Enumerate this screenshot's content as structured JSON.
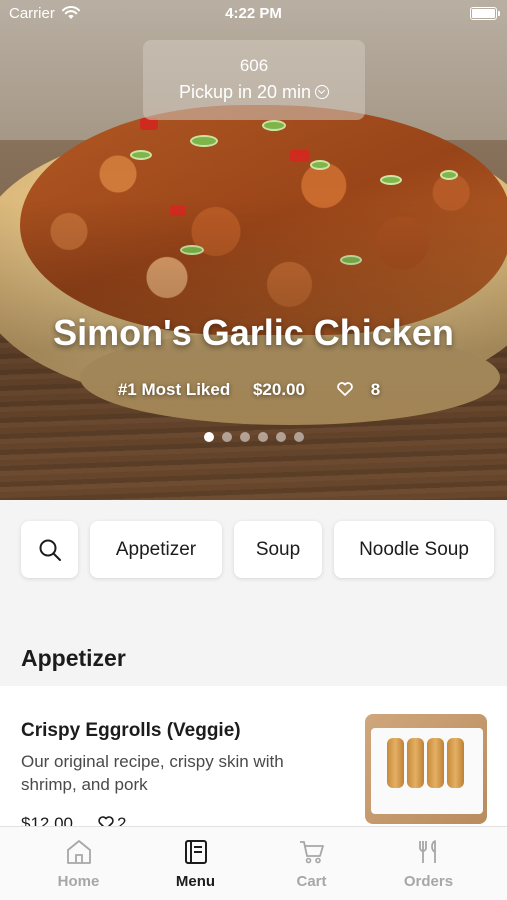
{
  "status_bar": {
    "carrier": "Carrier",
    "time": "4:22 PM"
  },
  "pickup": {
    "store": "606",
    "pickup_text": "Pickup in 20 min"
  },
  "hero": {
    "title": "Simon's Garlic Chicken",
    "badge": "#1 Most Liked",
    "price": "$20.00",
    "likes": "8",
    "carousel": {
      "total": 6,
      "active": 1
    }
  },
  "categories": {
    "search_icon": "search-icon",
    "items": [
      {
        "label": "Appetizer"
      },
      {
        "label": "Soup"
      },
      {
        "label": "Noodle Soup"
      }
    ]
  },
  "section": {
    "title": "Appetizer"
  },
  "menu_items": [
    {
      "name": "Crispy Eggrolls (Veggie)",
      "description": "Our original recipe, crispy skin with shrimp, and pork",
      "price": "$12.00",
      "likes": "2"
    }
  ],
  "tab_bar": {
    "tabs": [
      {
        "label": "Home",
        "icon": "home-icon",
        "active": false
      },
      {
        "label": "Menu",
        "icon": "menu-book-icon",
        "active": true
      },
      {
        "label": "Cart",
        "icon": "cart-icon",
        "active": false
      },
      {
        "label": "Orders",
        "icon": "fork-knife-icon",
        "active": false
      }
    ]
  },
  "colors": {
    "text": "#1c1c1c",
    "muted": "#a7a7a7",
    "background": "#f4f4f4"
  }
}
